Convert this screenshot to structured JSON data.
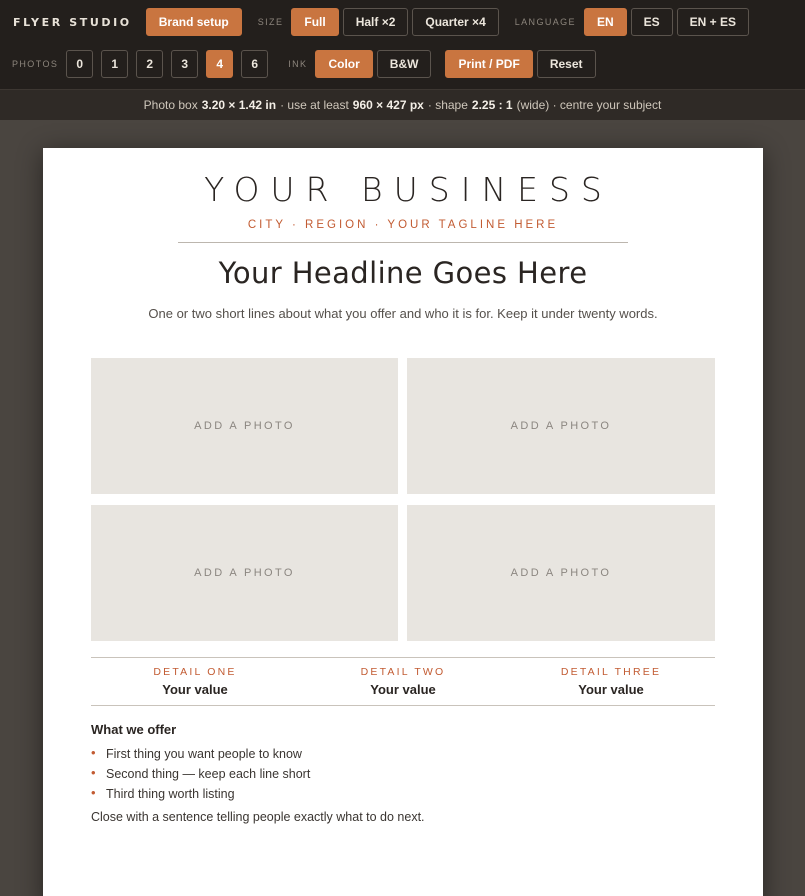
{
  "toolbar": {
    "brand": "FLYER STUDIO",
    "brand_setup": "Brand setup",
    "size_label": "SIZE",
    "size_options": [
      "Full",
      "Half ×2",
      "Quarter ×4"
    ],
    "language_label": "LANGUAGE",
    "language_options": [
      "EN",
      "ES",
      "EN + ES"
    ],
    "photos_label": "PHOTOS",
    "photo_counts": [
      "0",
      "1",
      "2",
      "3",
      "4",
      "6"
    ],
    "ink_label": "INK",
    "ink_options": [
      "Color",
      "B&W"
    ],
    "print_label": "Print / PDF",
    "reset_label": "Reset",
    "selected": {
      "size": "Full",
      "language": "EN",
      "photos": "4",
      "ink": "Color"
    },
    "accent_color": "#c97540"
  },
  "hint": {
    "photo_box_label": "Photo box",
    "photo_box_value": "3.20 × 1.42 in",
    "use_label": "· use at least",
    "use_value": "960 × 427 px",
    "shape_label": "· shape",
    "shape_value": "2.25 : 1",
    "shape_note": "(wide) · centre your subject"
  },
  "flyer": {
    "business": "YOUR BUSINESS",
    "tagline": "CITY · REGION · YOUR TAGLINE HERE",
    "headline": "Your Headline Goes Here",
    "subtext": "One or two short lines about what you offer and who it is for. Keep it under twenty words.",
    "photo_placeholder": "ADD A PHOTO",
    "details": [
      {
        "label": "DETAIL ONE",
        "value": "Your value"
      },
      {
        "label": "DETAIL TWO",
        "value": "Your value"
      },
      {
        "label": "DETAIL THREE",
        "value": "Your value"
      }
    ],
    "offer_heading": "What we offer",
    "offer_items": [
      "First thing you want people to know",
      "Second thing — keep each line short",
      "Third thing worth listing"
    ],
    "closing": "Close with a sentence telling people exactly what to do next.",
    "accent_color": "#c25b32"
  }
}
